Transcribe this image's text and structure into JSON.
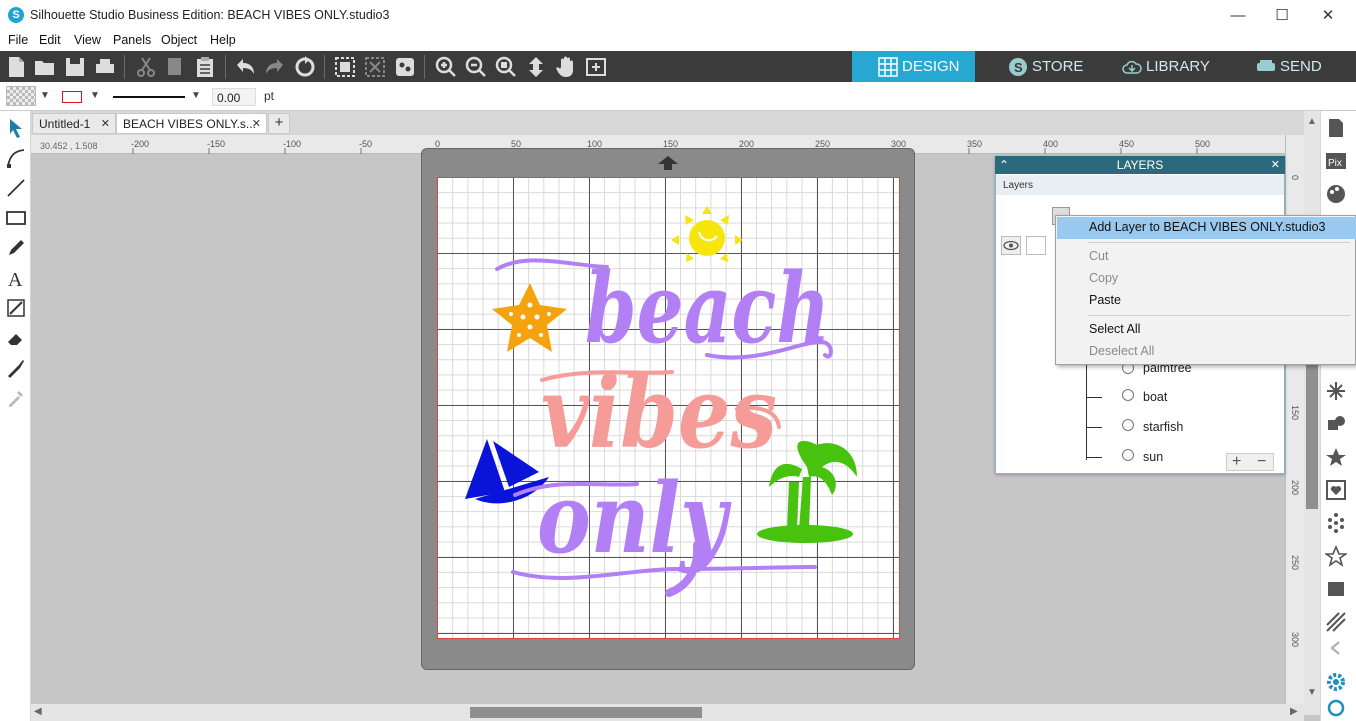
{
  "window": {
    "title": "Silhouette Studio Business Edition: BEACH VIBES ONLY.studio3",
    "app_icon": "S",
    "controls": {
      "minimize": "—",
      "maximize": "☐",
      "close": "✕"
    }
  },
  "menu": [
    "File",
    "Edit",
    "View",
    "Panels",
    "Object",
    "Help"
  ],
  "toolbar": {
    "icons": [
      "new-document-icon",
      "open-folder-icon",
      "save-icon",
      "print-icon",
      "cut-icon",
      "copy-icon",
      "paste-icon",
      "undo-icon",
      "redo-icon",
      "redraw-icon",
      "group-icon",
      "ungroup-icon",
      "compound-icon",
      "zoom-in-icon",
      "zoom-out-icon",
      "zoom-select-icon",
      "move-down-icon",
      "pan-hand-icon",
      "fit-page-icon"
    ],
    "nav_tabs": [
      {
        "label": "DESIGN",
        "active": true
      },
      {
        "label": "STORE",
        "active": false
      },
      {
        "label": "LIBRARY",
        "active": false
      },
      {
        "label": "SEND",
        "active": false
      }
    ]
  },
  "properties": {
    "line_width": "0.00",
    "unit": "pt"
  },
  "doc_tabs": [
    {
      "label": "Untitled-1",
      "active": false
    },
    {
      "label": "BEACH VIBES ONLY.s...",
      "active": true
    }
  ],
  "ruler": {
    "coordinates": "30.452 , 1.508",
    "h_ticks": [
      "-200",
      "-150",
      "-100",
      "-50",
      "0",
      "50",
      "100",
      "150",
      "200",
      "250",
      "300",
      "350",
      "400",
      "450",
      "500"
    ],
    "v_ticks": [
      "0",
      "150",
      "200",
      "250",
      "300"
    ]
  },
  "artwork": {
    "words": [
      "beach",
      "vibes",
      "only"
    ],
    "colors": {
      "beach": "#b27ff5",
      "vibes": "#f59b98",
      "only": "#b27ff5",
      "sun": "#f7e60d",
      "starfish": "#f5a20f",
      "boat": "#0a14d9",
      "palmtree": "#46c20f"
    }
  },
  "layers_panel": {
    "title": "LAYERS",
    "subtitle": "Layers",
    "items": [
      "palmtree",
      "boat",
      "starfish",
      "sun"
    ]
  },
  "context_menu": {
    "items": [
      {
        "label": "Add Layer to BEACH VIBES ONLY.studio3",
        "disabled": false,
        "highlighted": true
      },
      {
        "label": "Cut",
        "disabled": true
      },
      {
        "label": "Copy",
        "disabled": true
      },
      {
        "label": "Paste",
        "disabled": false
      },
      {
        "label": "Select All",
        "disabled": false
      },
      {
        "label": "Deselect All",
        "disabled": true
      }
    ]
  }
}
